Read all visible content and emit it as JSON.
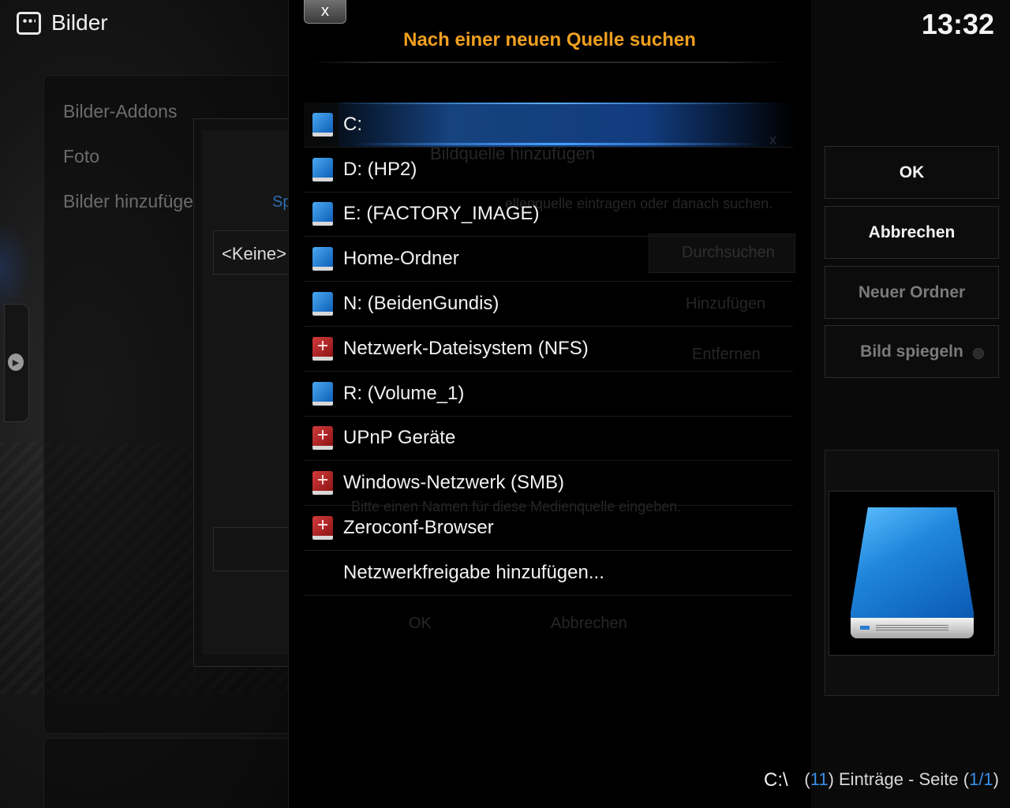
{
  "header": {
    "title": "Bilder",
    "clock": "13:32"
  },
  "background": {
    "menu_items": [
      "Bilder-Addons",
      "Foto",
      "Bilder hinzufügen..."
    ],
    "keine": "<Keine>",
    "sp_text": "Sp",
    "ghost_dialog_title": "Bildquelle hinzufügen",
    "ghost_instruction": "ellenquelle eintragen oder danach suchen.",
    "ghost_browse": "Durchsuchen",
    "ghost_add": "Hinzufügen",
    "ghost_remove": "Entfernen",
    "ghost_name_hint": "Bitte einen Namen für diese Medienquelle eingeben.",
    "ghost_ok": "OK",
    "ghost_cancel": "Abbrechen",
    "ghost_close": "x"
  },
  "dialog": {
    "close_label": "x",
    "title": "Nach einer neuen Quelle suchen",
    "items": [
      {
        "label": "C:",
        "icon": "blue-drive-icon",
        "selected": true
      },
      {
        "label": "D: (HP2)",
        "icon": "blue-drive-icon"
      },
      {
        "label": "E: (FACTORY_IMAGE)",
        "icon": "blue-drive-icon"
      },
      {
        "label": "Home-Ordner",
        "icon": "blue-drive-icon"
      },
      {
        "label": "N: (BeidenGundis)",
        "icon": "blue-drive-icon"
      },
      {
        "label": "Netzwerk-Dateisystem (NFS)",
        "icon": "red-network-drive-icon"
      },
      {
        "label": "R: (Volume_1)",
        "icon": "blue-drive-icon"
      },
      {
        "label": "UPnP Geräte",
        "icon": "red-network-drive-icon"
      },
      {
        "label": "Windows-Netzwerk (SMB)",
        "icon": "red-network-drive-icon"
      },
      {
        "label": "Zeroconf-Browser",
        "icon": "red-network-drive-icon"
      },
      {
        "label": "Netzwerkfreigabe hinzufügen...",
        "icon": ""
      }
    ],
    "path": "C:\\"
  },
  "buttons": {
    "ok": "OK",
    "cancel": "Abbrechen",
    "new_folder": "Neuer Ordner",
    "flip_image": "Bild spiegeln"
  },
  "footer": {
    "count": "11",
    "entries_text": ") Einträge - Seite (",
    "open_paren": "(",
    "page": "1/1",
    "close_paren": ")"
  },
  "colors": {
    "title": "#f0a020",
    "accent_blue": "#3a8ee8",
    "selected_highlight": "#2878e6"
  }
}
